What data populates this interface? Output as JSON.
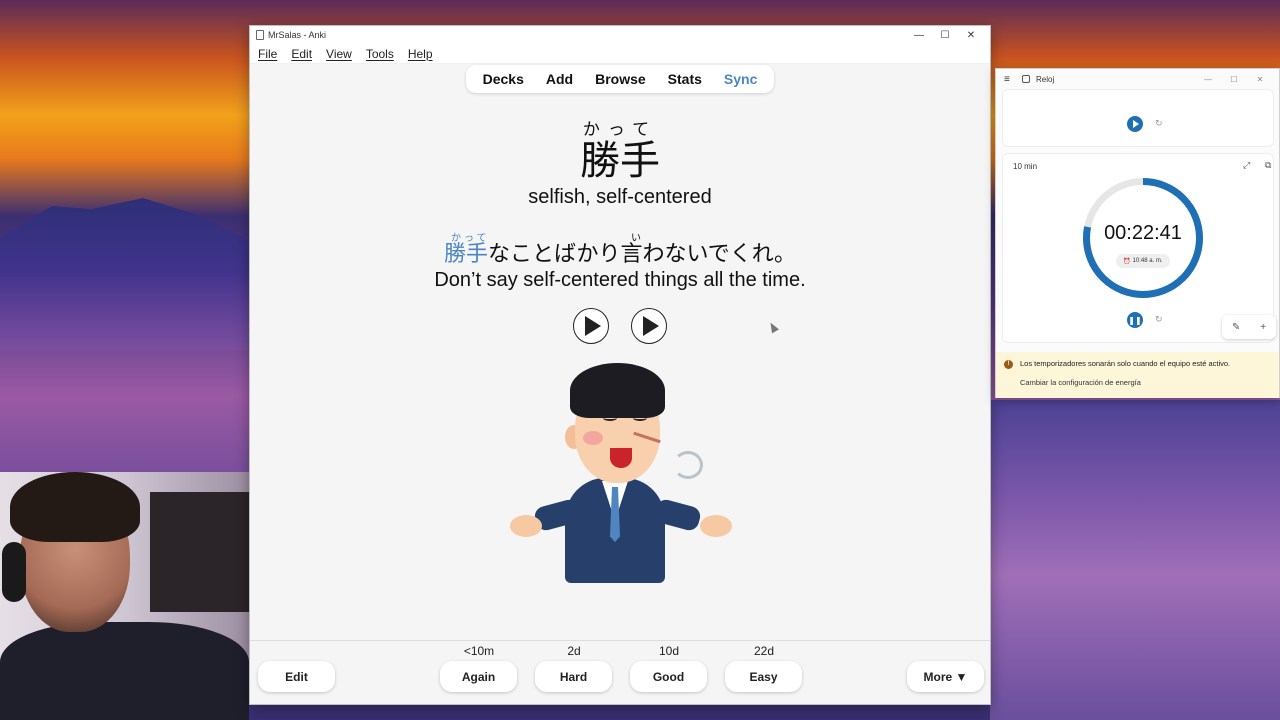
{
  "anki": {
    "title": "MrSalas - Anki",
    "menu": [
      "File",
      "Edit",
      "View",
      "Tools",
      "Help"
    ],
    "nav": [
      "Decks",
      "Add",
      "Browse",
      "Stats",
      "Sync"
    ],
    "card": {
      "reading": "かって",
      "word": "勝手",
      "meaning": "selfish, self-centered",
      "sentence_furigana_1": "かって",
      "sentence_furigana_2": "い",
      "sentence_highlight": "勝手",
      "sentence_rest": "なことばかり言わないでくれ。",
      "translation": "Don’t say self-centered things all the time."
    },
    "intervals": [
      "<10m",
      "2d",
      "10d",
      "22d"
    ],
    "buttons": {
      "edit": "Edit",
      "again": "Again",
      "hard": "Hard",
      "good": "Good",
      "easy": "Easy",
      "more": "More ▼"
    }
  },
  "reloj": {
    "title": "Reloj",
    "timer_label": "10 min",
    "time": "00:22:41",
    "end_time": "10:48 a. m.",
    "notice": "Los temporizadores sonarán solo cuando el equipo esté activo.",
    "notice_link": "Cambiar la configuración de energía"
  },
  "colors": {
    "accent": "#4a86c4",
    "timer_blue": "#1f6fb4"
  }
}
